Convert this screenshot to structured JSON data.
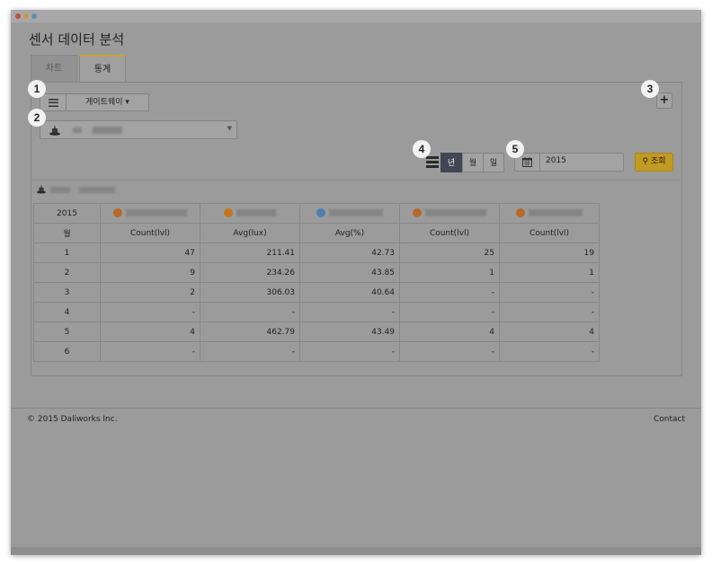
{
  "page": {
    "title": "센서 데이터 분석"
  },
  "tabs": [
    {
      "label": "차트"
    },
    {
      "label": "통계"
    }
  ],
  "toolbar": {
    "gateway_label": "게이트웨이 ▾",
    "plus_label": "+"
  },
  "period": {
    "year_label": "년",
    "month_label": "월",
    "day_label": "일"
  },
  "date": {
    "value": "2015"
  },
  "search": {
    "label": "조회"
  },
  "badges": [
    "1",
    "2",
    "3",
    "4",
    "5"
  ],
  "table": {
    "year": "2015",
    "month_header": "월",
    "units": [
      "Count(lvl)",
      "Avg(lux)",
      "Avg(%)",
      "Count(lvl)",
      "Count(lvl)"
    ],
    "sensor_icon_colors": [
      "#b56a2a",
      "#c4741b",
      "#4f7fb0",
      "#b56a2a",
      "#b56a2a"
    ],
    "rows": [
      [
        "1",
        "47",
        "211.41",
        "42.73",
        "25",
        "19"
      ],
      [
        "2",
        "9",
        "234.26",
        "43.85",
        "1",
        "1"
      ],
      [
        "3",
        "2",
        "306.03",
        "40.64",
        "-",
        "-"
      ],
      [
        "4",
        "-",
        "-",
        "-",
        "-",
        "-"
      ],
      [
        "5",
        "4",
        "462.79",
        "43.49",
        "4",
        "4"
      ],
      [
        "6",
        "-",
        "-",
        "-",
        "-",
        "-"
      ]
    ]
  },
  "footer": {
    "copyright": "© 2015 Daliworks Inc.",
    "contact": "Contact"
  }
}
